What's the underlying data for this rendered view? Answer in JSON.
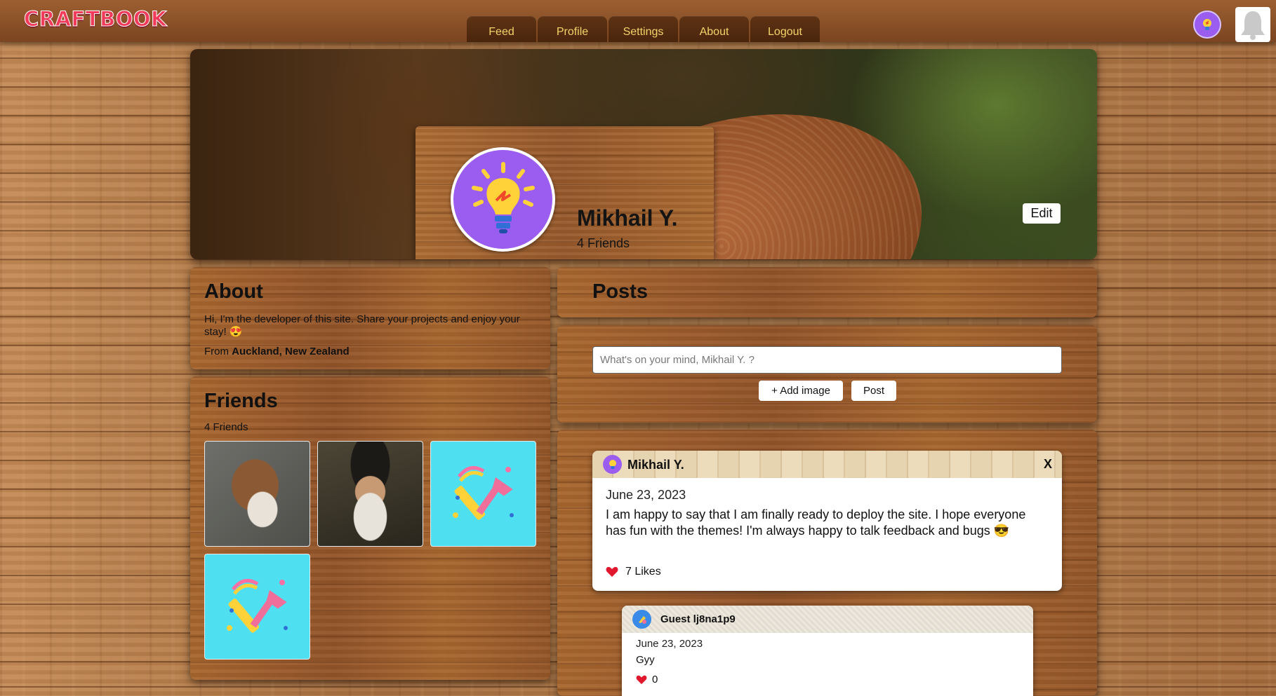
{
  "app": {
    "logo": "CRAFTBOOK"
  },
  "nav": {
    "tabs": [
      {
        "label": "Feed"
      },
      {
        "label": "Profile"
      },
      {
        "label": "Settings"
      },
      {
        "label": "About"
      },
      {
        "label": "Logout"
      }
    ],
    "user_avatar_icon": "lightbulb-icon",
    "notification_icon": "bell-icon"
  },
  "profile": {
    "name": "Mikhail Y.",
    "friends_count": "4 Friends",
    "edit_label": "Edit",
    "avatar_icon": "lightbulb-icon",
    "avatar_color": "#9b5cf0"
  },
  "about": {
    "title": "About",
    "bio": "Hi, I'm the developer of this site. Share your projects and enjoy your stay! 😍",
    "from_prefix": "From",
    "location": "Auckland, New Zealand"
  },
  "friends": {
    "title": "Friends",
    "count": "4 Friends",
    "items": [
      {
        "image": "sparrow-photo"
      },
      {
        "image": "leonardo-portrait"
      },
      {
        "image": "tools-illustration"
      },
      {
        "image": "tools-illustration"
      }
    ]
  },
  "posts": {
    "title": "Posts",
    "composer": {
      "placeholder": "What's on your mind, Mikhail Y. ?",
      "add_image_label": "+ Add image",
      "post_label": "Post"
    },
    "items": [
      {
        "author": "Mikhail Y.",
        "close_label": "X",
        "date": "June 23, 2023",
        "text": "I am happy to say that I am finally ready to deploy the site. I hope everyone has fun with the themes! I'm always happy to talk feedback and bugs 😎",
        "likes_label": "7 Likes",
        "like_icon": "heart-icon",
        "comments": [
          {
            "author": "Guest lj8na1p9",
            "date": "June 23, 2023",
            "text": "Gyy",
            "likes": "0",
            "like_icon": "heart-icon"
          }
        ]
      }
    ]
  },
  "colors": {
    "nav_text": "#f3d36a",
    "logo": "#f23a5a",
    "avatar_purple": "#9b5cf0",
    "tile_cyan": "#4ee0f1",
    "heart": "#e0182d"
  }
}
